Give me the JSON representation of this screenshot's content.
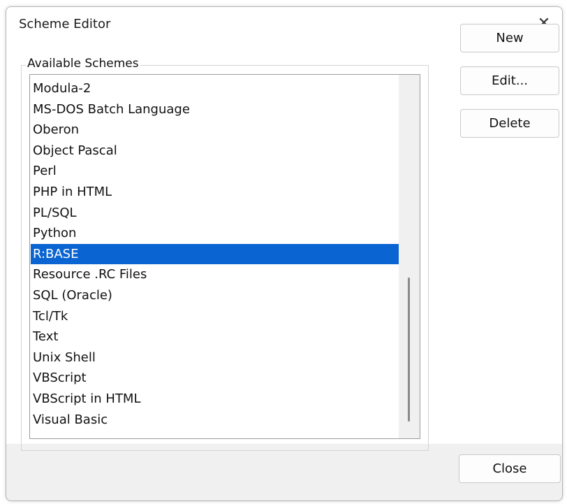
{
  "window": {
    "title": "Scheme Editor",
    "close_glyph": "✕"
  },
  "group": {
    "label": "Available Schemes"
  },
  "schemes": [
    "Modula-2",
    "MS-DOS Batch Language",
    "Oberon",
    "Object Pascal",
    "Perl",
    "PHP in HTML",
    "PL/SQL",
    "Python",
    "R:BASE",
    "Resource .RC Files",
    "SQL (Oracle)",
    "Tcl/Tk",
    "Text",
    "Unix Shell",
    "VBScript",
    "VBScript in HTML",
    "Visual Basic"
  ],
  "selected_scheme": "R:BASE",
  "buttons": {
    "new": "New",
    "edit": "Edit...",
    "delete": "Delete",
    "close": "Close"
  },
  "colors": {
    "selection": "#0a64d1",
    "dialog_background": "#f0f0f0"
  }
}
